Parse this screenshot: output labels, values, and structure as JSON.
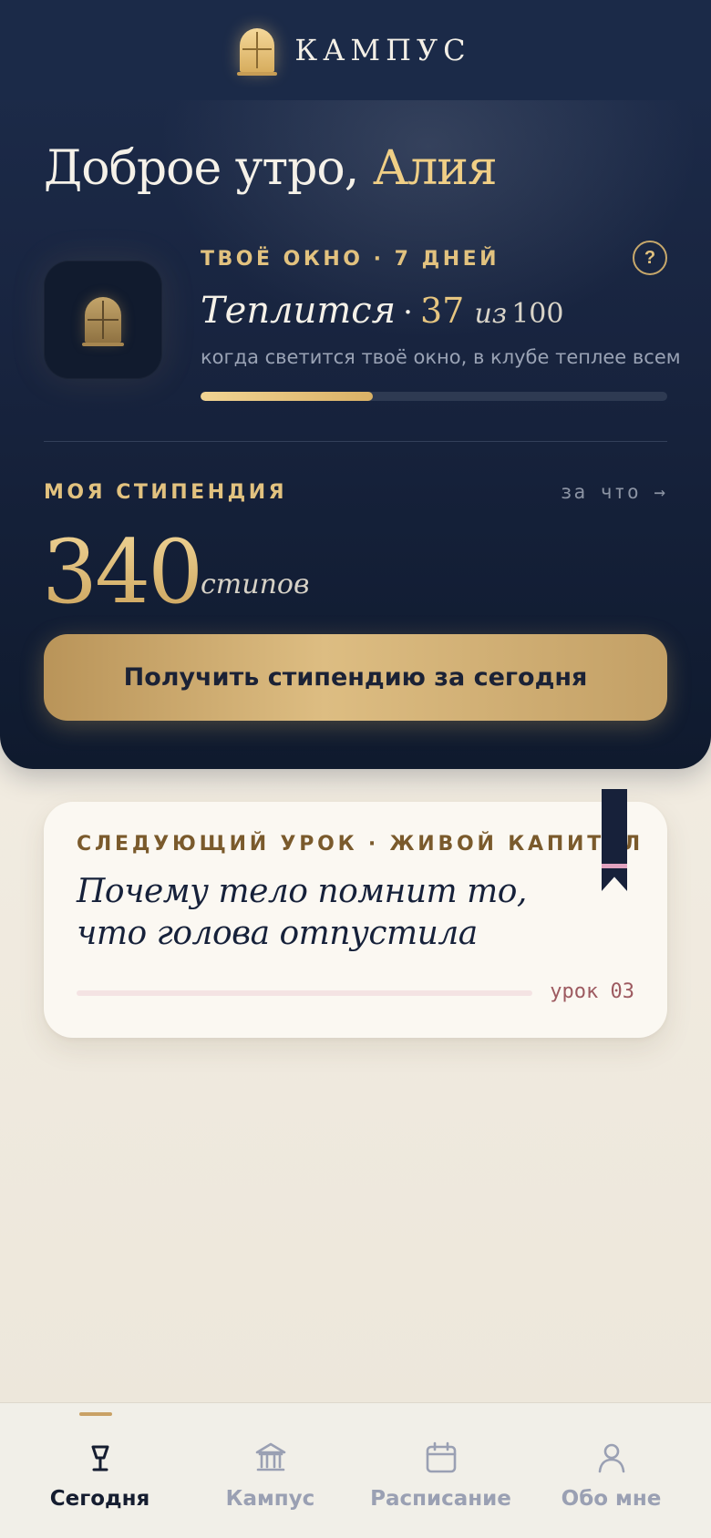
{
  "header": {
    "brand": "КАМПУС",
    "logo_icon": "window-icon"
  },
  "greeting": {
    "prefix": "Доброе утро,",
    "name": "Алия"
  },
  "window_status": {
    "label": "ТВОЁ ОКНО · 7 ДНЕЙ",
    "help": "?",
    "status": "Теплится",
    "separator": "·",
    "score": "37",
    "of_label": "из",
    "max": "100",
    "hint": "когда светится твоё окно, в клубе теплее всем",
    "progress": 0.37
  },
  "stipend": {
    "label": "МОЯ СТИПЕНДИЯ",
    "why_link": "за что →",
    "amount": "340",
    "unit": "стипов",
    "claim_button": "Получить стипендию за сегодня"
  },
  "lesson": {
    "label": "СЛЕДУЮЩИЙ УРОК · ЖИВОЙ КАПИТАЛ",
    "title": "Почему тело помнит то, что голова отпустила",
    "number": "урок 03",
    "progress": 0.0
  },
  "tabs": [
    {
      "label": "Сегодня",
      "icon": "lamp-icon",
      "active": true
    },
    {
      "label": "Кампус",
      "icon": "building-icon",
      "active": false
    },
    {
      "label": "Расписание",
      "icon": "calendar-icon",
      "active": false
    },
    {
      "label": "Обо мне",
      "icon": "user-icon",
      "active": false
    }
  ],
  "colors": {
    "navy": "#1b2a48",
    "gold": "#e2c27f",
    "cream": "#f6f1e7",
    "lesson_accent": "#9d5a60"
  }
}
